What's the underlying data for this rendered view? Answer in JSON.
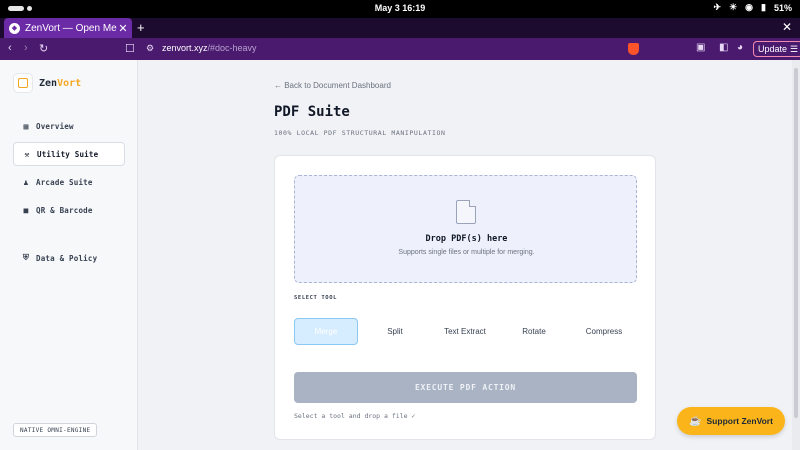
{
  "os": {
    "clock": "May 3  16:19",
    "battery": "51%"
  },
  "browser": {
    "tab_title": "ZenVort — Open Media",
    "tab_close": "✕",
    "new_tab": "+",
    "window_close": "✕",
    "url_host": "zenvort.xyz",
    "url_path": "/#doc-heavy",
    "update_label": "Update"
  },
  "sidebar": {
    "logo_text_a": "Zen",
    "logo_text_b": "Vort",
    "items": [
      {
        "icon": "▦",
        "label": "Overview"
      },
      {
        "icon": "⚒",
        "label": "Utility Suite"
      },
      {
        "icon": "♟",
        "label": "Arcade Suite"
      },
      {
        "icon": "■",
        "label": "QR & Barcode"
      },
      {
        "icon": "⛨",
        "label": "Data & Policy"
      }
    ],
    "engine_badge": "NATIVE OMNI-ENGINE"
  },
  "page": {
    "back_link": "← Back to Document Dashboard",
    "title": "PDF Suite",
    "subtitle": "100% LOCAL PDF STRUCTURAL MANIPULATION"
  },
  "dropzone": {
    "title": "Drop PDF(s) here",
    "subtitle": "Supports single files or multiple for merging."
  },
  "tools": {
    "section_label": "SELECT TOOL",
    "items": [
      "Merge",
      "Split",
      "Text Extract",
      "Rotate",
      "Compress"
    ],
    "selected": "Merge"
  },
  "action": {
    "execute_label": "EXECUTE PDF ACTION",
    "status": "Select a tool and drop a file ✓"
  },
  "support": {
    "label": "Support ZenVort"
  },
  "colors": {
    "accent": "#f5a623",
    "browser_tab": "#6b2aa6",
    "support_button": "#fbb51a"
  }
}
